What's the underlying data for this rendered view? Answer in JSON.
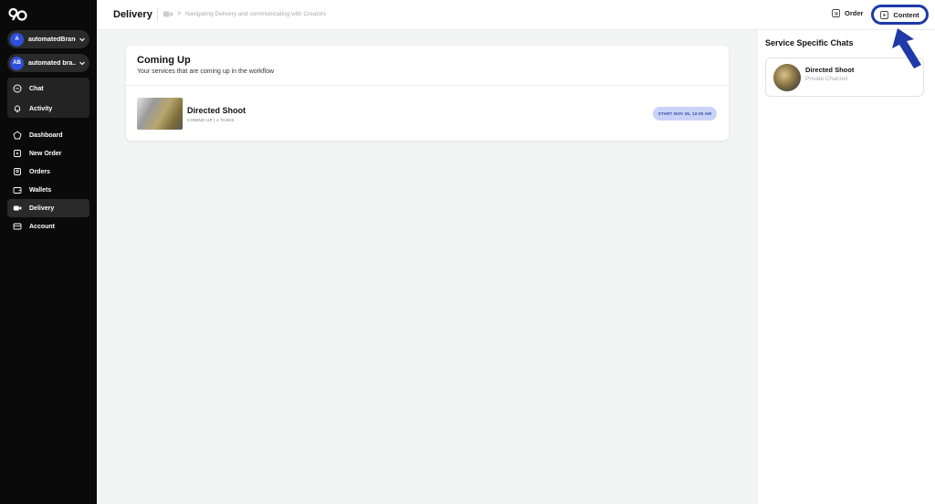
{
  "sidebar": {
    "accounts": [
      {
        "initials": "A",
        "name": "automatedBrand"
      },
      {
        "initials": "AB",
        "name": "automated bra..."
      }
    ],
    "group_items": [
      {
        "label": "Chat",
        "icon": "chat-icon"
      },
      {
        "label": "Activity",
        "icon": "bell-icon"
      }
    ],
    "nav_items": [
      {
        "label": "Dashboard",
        "icon": "dashboard-icon"
      },
      {
        "label": "New Order",
        "icon": "new-order-icon"
      },
      {
        "label": "Orders",
        "icon": "orders-icon"
      },
      {
        "label": "Wallets",
        "icon": "wallet-icon"
      },
      {
        "label": "Delivery",
        "icon": "delivery-icon",
        "active": true
      },
      {
        "label": "Account",
        "icon": "account-icon"
      }
    ]
  },
  "header": {
    "title": "Delivery",
    "breadcrumb": "Navigating Delivery and communicating with Creators",
    "order_label": "Order",
    "content_label": "Content"
  },
  "coming_up": {
    "title": "Coming Up",
    "subtitle": "Your services that are coming up in the workflow",
    "items": [
      {
        "title": "Directed Shoot",
        "meta": "COMING UP | 4 TASKS",
        "badge": "START NOV 26, 12:00 AM"
      }
    ]
  },
  "right_panel": {
    "title": "Service Specific Chats",
    "chats": [
      {
        "name": "Directed Shoot",
        "sub": "Private Channel"
      }
    ]
  },
  "colors": {
    "sidebar_bg": "#0a0a0a",
    "accent_blue": "#2f4fd8",
    "badge_bg": "#c9d3f7",
    "annotation": "#1e3aa8"
  }
}
